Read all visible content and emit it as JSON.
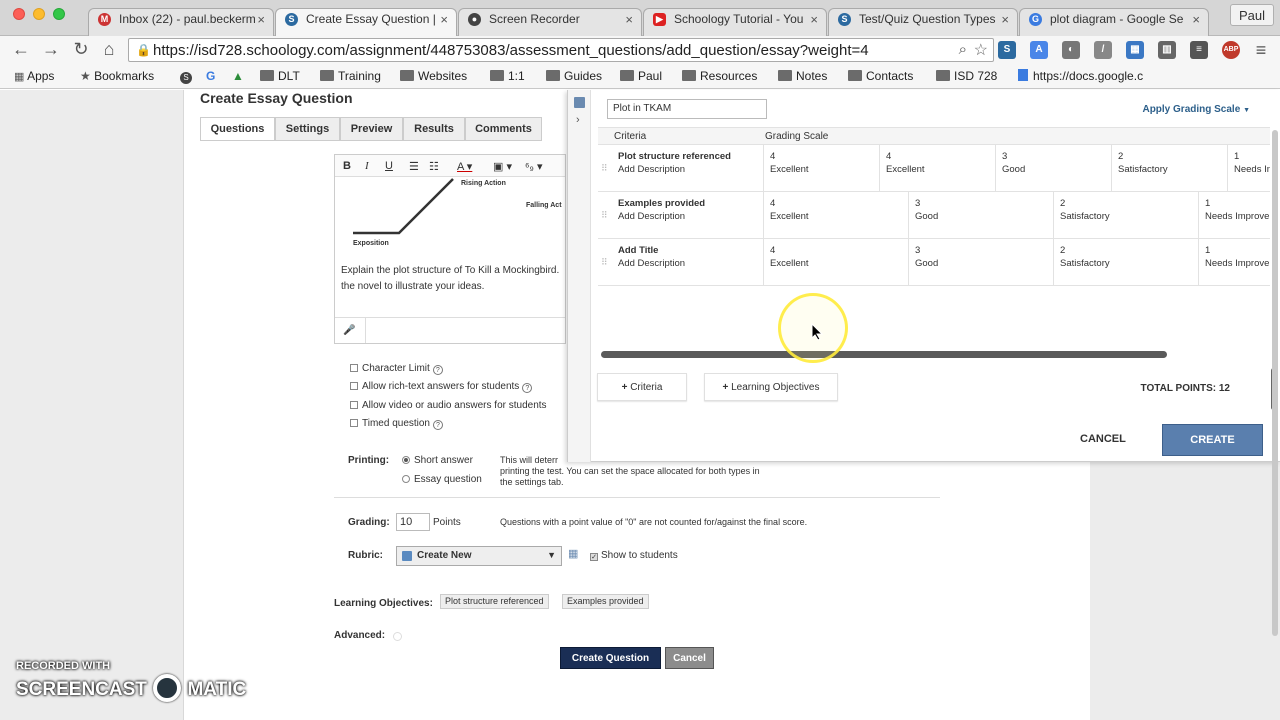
{
  "browser": {
    "tabs": [
      {
        "label": "Inbox (22) - paul.beckerm",
        "icon": "gmail-icon",
        "color": "#c33"
      },
      {
        "label": "Create Essay Question |",
        "icon": "schoology-icon",
        "color": "#2c6aa0"
      },
      {
        "label": "Screen Recorder",
        "icon": "screencast-icon",
        "color": "#444"
      },
      {
        "label": "Schoology Tutorial - You",
        "icon": "youtube-icon",
        "color": "#d22"
      },
      {
        "label": "Test/Quiz Question Types",
        "icon": "schoology-icon",
        "color": "#2c6aa0"
      },
      {
        "label": "plot diagram - Google Se",
        "icon": "google-icon",
        "color": "#3a7be0"
      }
    ],
    "profile": "Paul",
    "url": "https://isd728.schoology.com/assignment/448753083/assessment_questions/add_question/essay?weight=4",
    "bookmarks": [
      "Apps",
      "Bookmarks",
      "DLT",
      "Training",
      "Websites",
      "1:1",
      "Guides",
      "Paul",
      "Resources",
      "Notes",
      "Contacts",
      "ISD 728",
      "https://docs.google.c"
    ]
  },
  "page": {
    "title": "Create Essay Question",
    "tabs": [
      "Questions",
      "Settings",
      "Preview",
      "Results",
      "Comments"
    ],
    "editor": {
      "diagram_labels": [
        "Rising Action",
        "Falling Act",
        "Exposition"
      ],
      "text_line1": "Explain the plot structure of To Kill a Mockingbird.",
      "text_line2": "the novel to illustrate your ideas."
    },
    "options": [
      "Character Limit",
      "Allow rich-text answers for students",
      "Allow video or audio answers for students",
      "Timed question"
    ],
    "printing": {
      "label": "Printing:",
      "short": "Short answer",
      "essay": "Essay question",
      "note1": "This will deterr",
      "note2": "printing the test. You can set the space allocated for both types in",
      "note3": "the settings tab."
    },
    "grading": {
      "label": "Grading:",
      "value": "10",
      "unit": "Points",
      "note": "Questions with a point value of \"0\" are not counted for/against the final score."
    },
    "rubric": {
      "label": "Rubric:",
      "selected": "Create New",
      "show_label": "Show to students"
    },
    "objectives": {
      "label": "Learning Objectives:",
      "tags": [
        "Plot structure referenced",
        "Examples provided"
      ]
    },
    "advanced_label": "Advanced:",
    "create_button": "Create Question",
    "cancel_button": "Cancel"
  },
  "rubric_modal": {
    "title_value": "Plot in TKAM",
    "apply_scale": "Apply Grading Scale",
    "col_criteria": "Criteria",
    "col_scale": "Grading Scale",
    "add_desc": "Add Description",
    "rows": [
      {
        "name": "Plot structure referenced",
        "levels": [
          {
            "pts": "4",
            "label": "Excellent"
          },
          {
            "pts": "4",
            "label": "Excellent"
          },
          {
            "pts": "3",
            "label": "Good"
          },
          {
            "pts": "2",
            "label": "Satisfactory"
          },
          {
            "pts": "1",
            "label": "Needs Im"
          }
        ]
      },
      {
        "name": "Examples provided",
        "levels": [
          {
            "pts": "4",
            "label": "Excellent"
          },
          {
            "pts": "3",
            "label": "Good"
          },
          {
            "pts": "2",
            "label": "Satisfactory"
          },
          {
            "pts": "1",
            "label": "Needs Improver"
          }
        ]
      },
      {
        "name": "Add Title",
        "levels": [
          {
            "pts": "4",
            "label": "Excellent"
          },
          {
            "pts": "3",
            "label": "Good"
          },
          {
            "pts": "2",
            "label": "Satisfactory"
          },
          {
            "pts": "1",
            "label": "Needs Improver"
          }
        ]
      }
    ],
    "add_criteria": "Criteria",
    "add_objectives": "Learning Objectives",
    "total_points": "TOTAL POINTS: 12",
    "cancel": "CANCEL",
    "create": "CREATE"
  },
  "watermark": {
    "line1": "RECORDED WITH",
    "line2a": "SCREENCAST",
    "line2b": "MATIC"
  }
}
